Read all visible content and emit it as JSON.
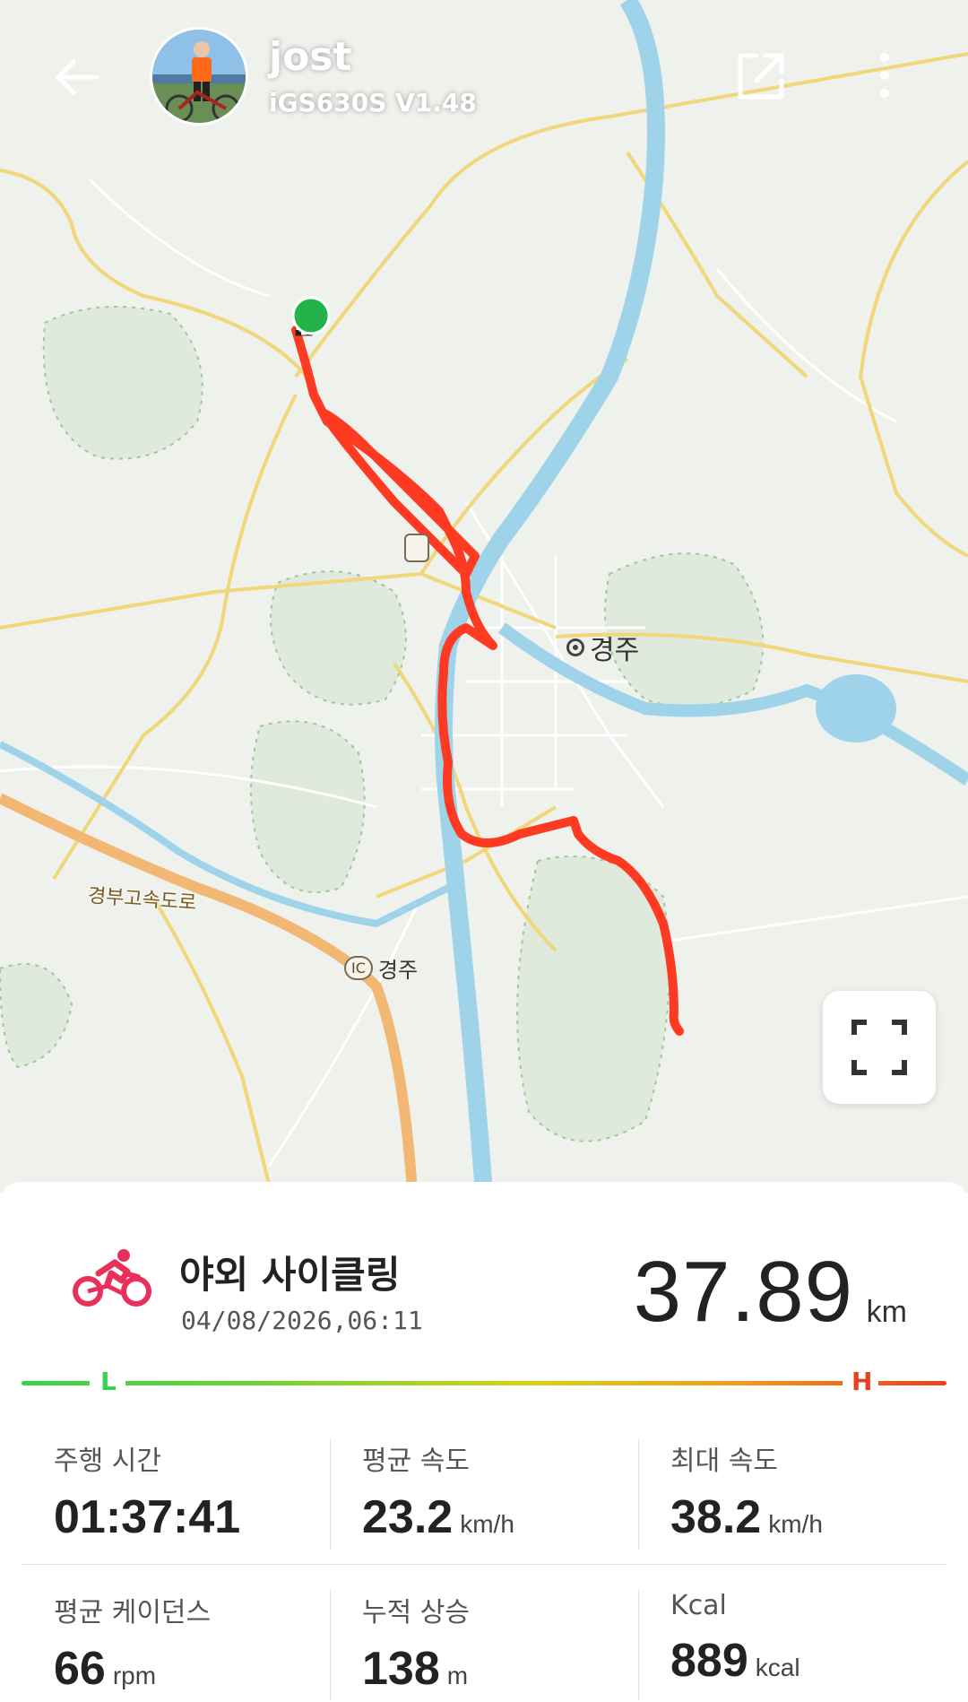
{
  "header": {
    "user_name": "jost",
    "device": "iGS630S  V1.48"
  },
  "map": {
    "city_label": "경주",
    "highway_label": "경부고속도로",
    "ic_badge": "IC",
    "ic_label": "경주",
    "route_color": "#ff3a22",
    "start_marker_color": "#22b34a",
    "river_color": "#9fd3ea",
    "road_color": "#f0d77a",
    "highway_color": "#f2b773"
  },
  "activity": {
    "title": "야외 사이클링",
    "datetime": "04/08/2026,06:11",
    "distance": "37.89",
    "distance_unit": "km",
    "icon_color": "#e8305a"
  },
  "scale": {
    "low_label": "L",
    "high_label": "H",
    "low_color": "#37d24b",
    "high_color": "#e8401e"
  },
  "stats": [
    {
      "label": "주행 시간",
      "value": "01:37:41",
      "unit": ""
    },
    {
      "label": "평균 속도",
      "value": "23.2",
      "unit": "km/h"
    },
    {
      "label": "최대 속도",
      "value": "38.2",
      "unit": "km/h"
    },
    {
      "label": "평균 케이던스",
      "value": "66",
      "unit": "rpm"
    },
    {
      "label": "누적 상승",
      "value": "138",
      "unit": "m"
    },
    {
      "label": "Kcal",
      "value": "889",
      "unit": "kcal"
    }
  ]
}
